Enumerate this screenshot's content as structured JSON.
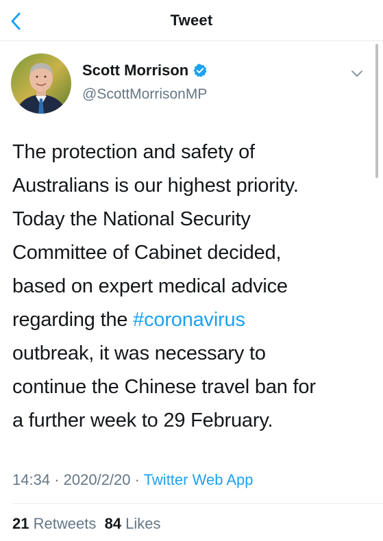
{
  "nav": {
    "title": "Tweet",
    "back_icon": "chevron-left-icon"
  },
  "author": {
    "name": "Scott Morrison",
    "handle": "@ScottMorrisonMP",
    "verified": true,
    "verified_icon": "verified-badge-icon"
  },
  "tweet": {
    "lines": [
      {
        "text": "The protection and safety of"
      },
      {
        "text": "Australians is our highest priority."
      },
      {
        "text": "Today the National Security"
      },
      {
        "text": "Committee of Cabinet decided,"
      },
      {
        "text": "based on expert medical advice"
      },
      {
        "before": "regarding the ",
        "hashtag": "#coronavirus"
      },
      {
        "text": "outbreak, it was necessary to"
      },
      {
        "text": "continue the Chinese travel ban for"
      },
      {
        "text": "a further week to 29 February."
      }
    ]
  },
  "meta": {
    "time": "14:34",
    "separator": "·",
    "date": "2020/2/20",
    "source": "Twitter Web App"
  },
  "stats": {
    "retweets_count": "21",
    "retweets_label": "Retweets",
    "likes_count": "84",
    "likes_label": "Likes"
  },
  "colors": {
    "accent": "#1da1f2",
    "secondary_text": "#657786",
    "primary_text": "#14171a"
  }
}
